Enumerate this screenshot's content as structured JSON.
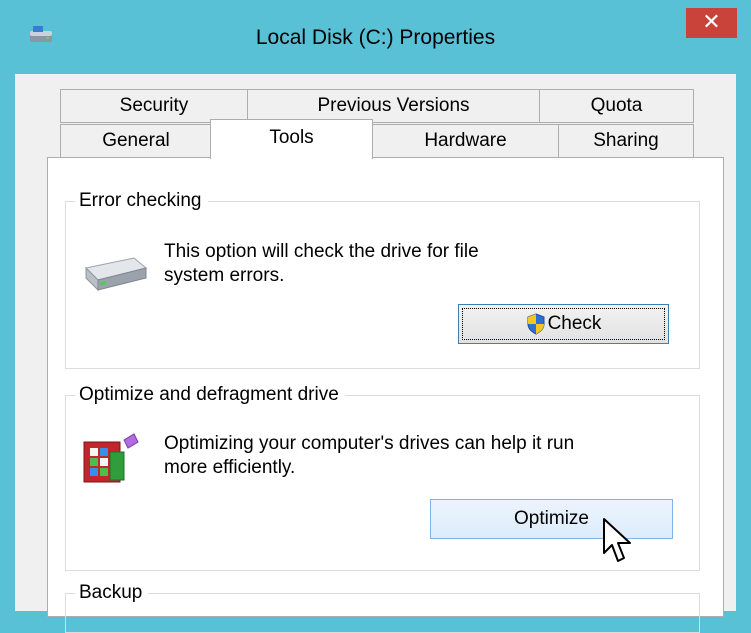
{
  "window": {
    "title": "Local Disk (C:) Properties",
    "close_glyph": "✕",
    "app_icon": "drive-icon"
  },
  "tabs": {
    "row1": [
      "Security",
      "Previous Versions",
      "Quota"
    ],
    "row2": [
      "General",
      "Tools",
      "Hardware",
      "Sharing"
    ],
    "selected": "Tools"
  },
  "error_checking": {
    "title": "Error checking",
    "description_line1": "This option will check the drive for file",
    "description_line2": "system errors.",
    "button_label": "Check",
    "button_icon": "uac-shield-icon"
  },
  "optimize": {
    "title": "Optimize and defragment drive",
    "description_line1": "Optimizing your computer's drives can help it run",
    "description_line2": "more efficiently.",
    "button_label": "Optimize"
  },
  "backup": {
    "title": "Backup"
  },
  "colors": {
    "title_bar": "#59c1d6",
    "close_button": "#c9433b",
    "panel": "#f0f0f0",
    "button_hover": "#dcecfc"
  }
}
